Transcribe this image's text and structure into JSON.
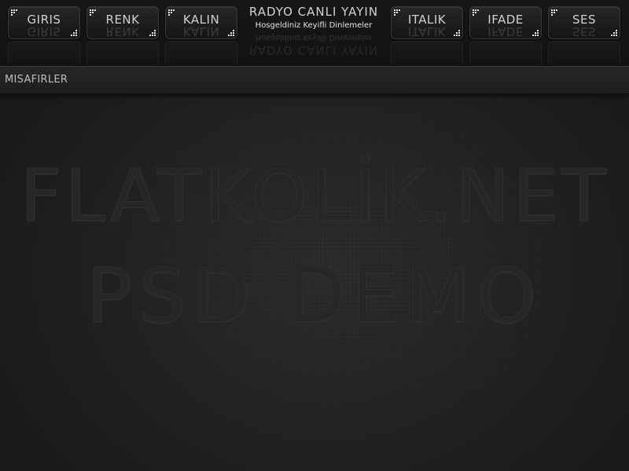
{
  "nav": {
    "left": [
      {
        "label": "GIRIS"
      },
      {
        "label": "RENK"
      },
      {
        "label": "KALIN"
      }
    ],
    "right": [
      {
        "label": "ITALIK"
      },
      {
        "label": "IFADE"
      },
      {
        "label": "SES"
      }
    ]
  },
  "brand": {
    "title": "RADYO CANLI YAYIN",
    "subtitle": "Hosgeldiniz Keyifli Dinlemeler"
  },
  "guests": {
    "label": "MISAFIRLER"
  },
  "watermark": {
    "line1": "FLATKOLİK.NET",
    "line2": "PSD DEMO"
  },
  "colors": {
    "background": "#1f1f1f",
    "button_border": "#3a3a3a",
    "text": "#cfcfcf"
  }
}
